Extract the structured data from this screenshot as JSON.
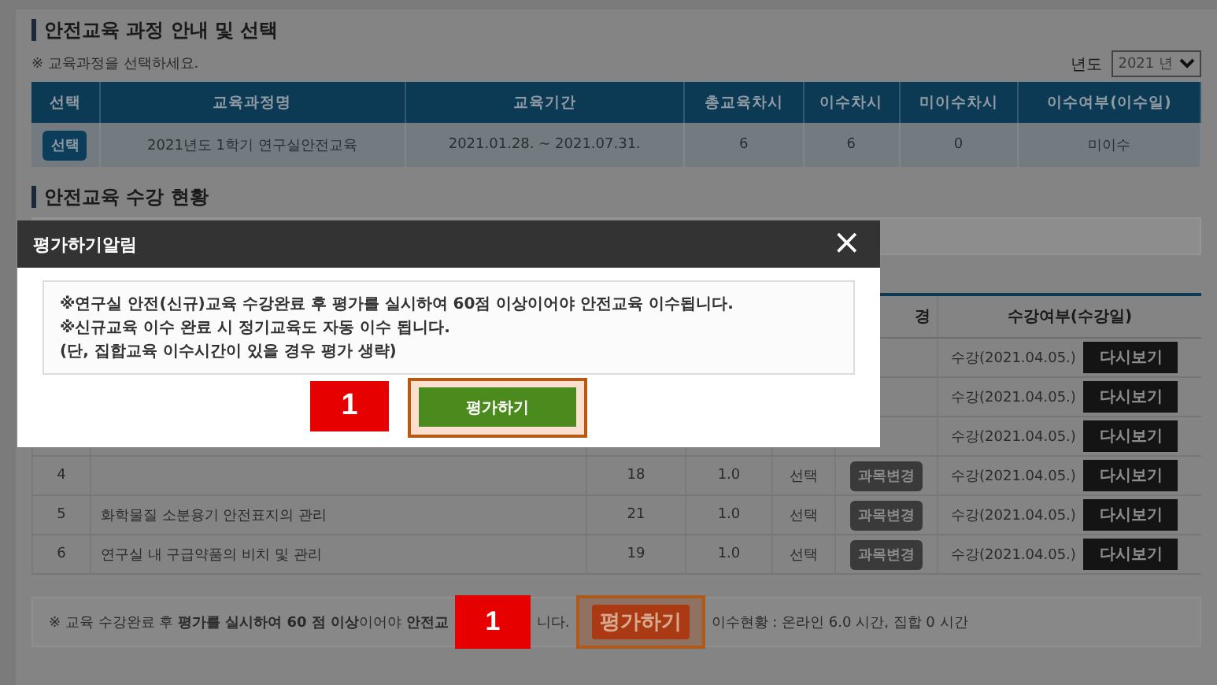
{
  "course_section": {
    "title": "안전교육 과정 안내 및 선택",
    "hint": "※ 교육과정을 선택하세요.",
    "year_label": "년도",
    "year_select": "2021 년",
    "table": {
      "columns": [
        "선택",
        "교육과정명",
        "교육기간",
        "총교육차시",
        "이수차시",
        "미이수차시",
        "이수여부(이수일)"
      ],
      "rows": [
        {
          "select_button": "선택",
          "course": "2021년도 1학기 연구실안전교육",
          "period": "2021.01.28. ~ 2021.07.31.",
          "total": "6",
          "done": "6",
          "remaining": "0",
          "status": "미이수"
        }
      ]
    }
  },
  "progress_section": {
    "title": "안전교육 수강 현황",
    "table": {
      "columns": [
        "경",
        "수강여부(수강일)"
      ],
      "rows": [
        {
          "status": "수강(2021.04.05.)",
          "review_button": "다시보기"
        },
        {
          "status": "수강(2021.04.05.)",
          "review_button": "다시보기"
        },
        {
          "status": "수강(2021.04.05.)",
          "review_button": "다시보기"
        },
        {
          "number": "4",
          "hours": "18",
          "credit": "1.0",
          "type": "선택",
          "change_button": "과목변경",
          "status": "수강(2021.04.05.)",
          "review_button": "다시보기"
        },
        {
          "number": "5",
          "name": "화학물질 소분용기 안전표지의 관리",
          "hours": "21",
          "credit": "1.0",
          "type": "선택",
          "change_button": "과목변경",
          "status": "수강(2021.04.05.)",
          "review_button": "다시보기"
        },
        {
          "number": "6",
          "name": "연구실 내 구급약품의 비치 및 관리",
          "hours": "19",
          "credit": "1.0",
          "type": "선택",
          "change_button": "과목변경",
          "status": "수강(2021.04.05.)",
          "review_button": "다시보기"
        }
      ]
    },
    "footer": {
      "notice_start": "※ 교육 수강완료 후 **평가를 실시하여 60 점 이상**이어야 **안전교**",
      "marker": "1",
      "notice_end": "니다.",
      "evaluate_button": "평가하기",
      "summary": "이수현황 : 온라인 6.0 시간, 집합 0 시간"
    }
  },
  "modal": {
    "title": "평가하기알림",
    "close": "×",
    "lines": [
      "※연구실 안전(신규)교육 수강완료 후 **평가를 실시하여 60점 이상**이어야 **안전교육 이수**됩니다.",
      "※신규교육 이수 완료 시 정기교육도 자동 이수 됩니다.",
      "(단, 집합교육 이수시간이 있을 경우 평가 생략)"
    ],
    "marker": "1",
    "evaluate_button": "평가하기"
  }
}
